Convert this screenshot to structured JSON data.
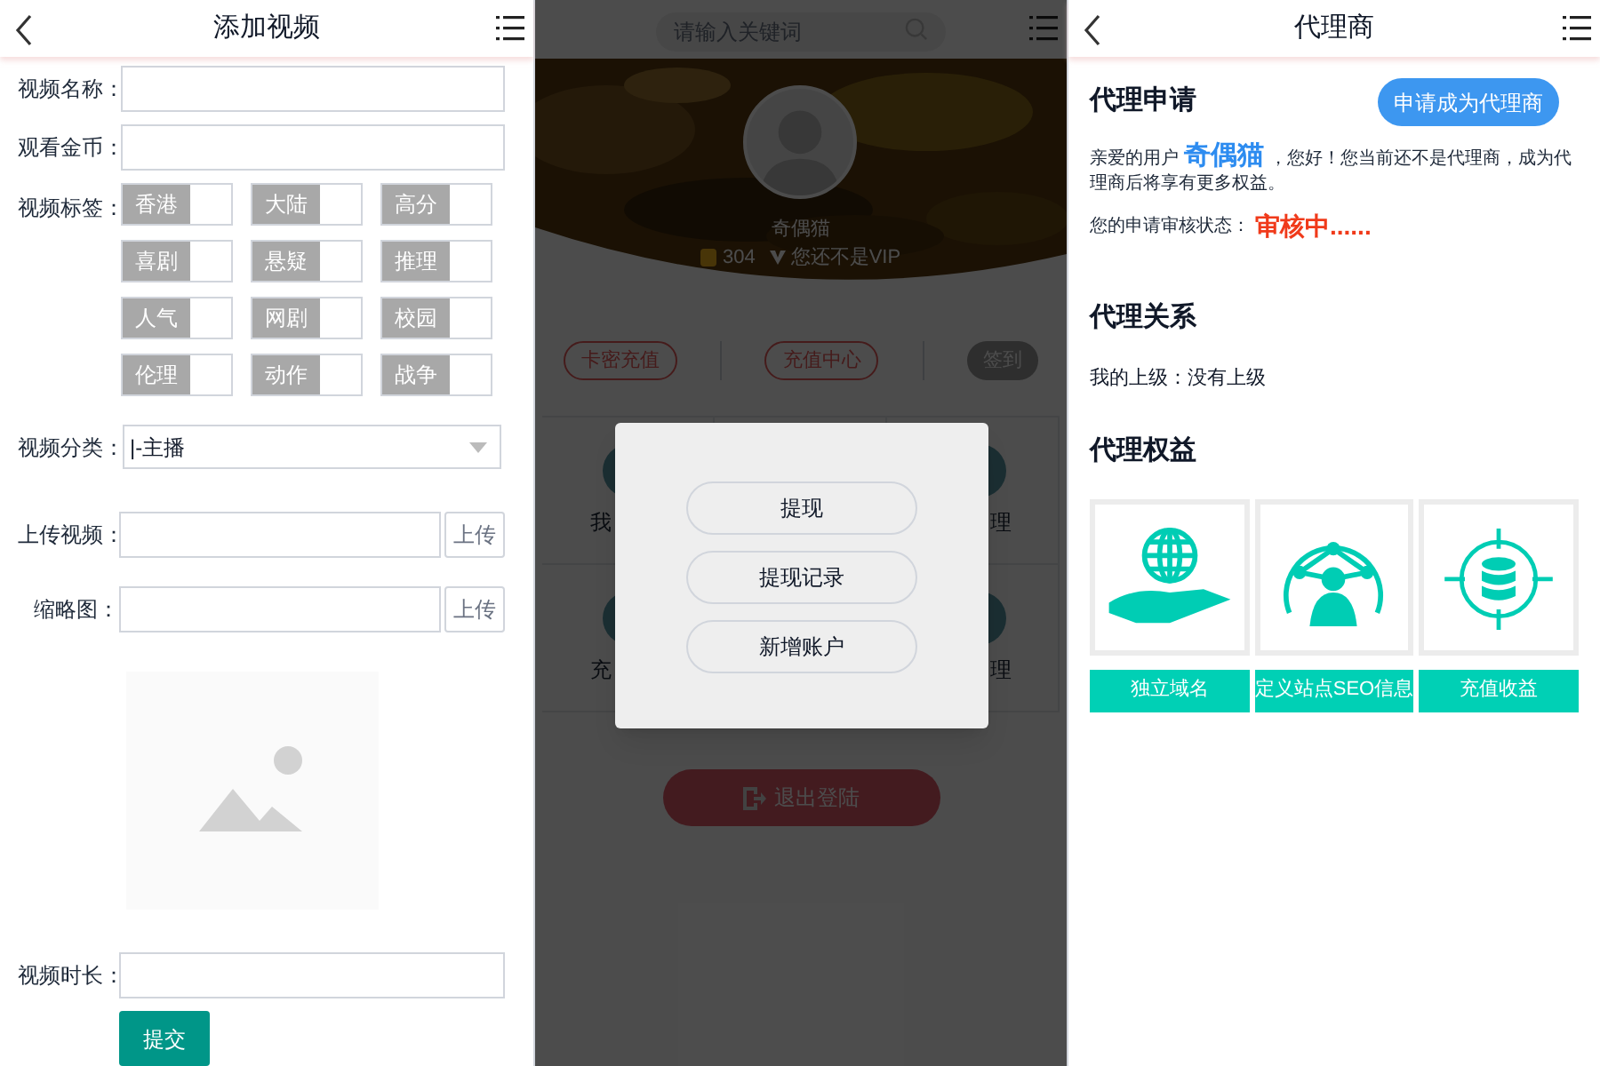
{
  "add_video": {
    "title": "添加视频",
    "fields": [
      {
        "label": "视频名称："
      },
      {
        "label": "观看金币："
      }
    ],
    "tags_label": "视频标签：",
    "tags": [
      {
        "label": "香港",
        "checked": false
      },
      {
        "label": "大陆",
        "checked": false
      },
      {
        "label": "高分",
        "checked": false
      },
      {
        "label": "喜剧",
        "checked": false
      },
      {
        "label": "悬疑",
        "checked": false
      },
      {
        "label": "推理",
        "checked": false
      },
      {
        "label": "人气",
        "checked": false
      },
      {
        "label": "网剧",
        "checked": false
      },
      {
        "label": "校园",
        "checked": false
      },
      {
        "label": "伦理",
        "checked": false
      },
      {
        "label": "动作",
        "checked": false
      },
      {
        "label": "战争",
        "checked": false
      }
    ],
    "category": {
      "label": "视频分类：",
      "value": "|-主播"
    },
    "uploads": [
      {
        "label": "上传视频：",
        "button": "上传"
      },
      {
        "label": "缩略图：",
        "button": "上传"
      }
    ],
    "duration": {
      "label": "视频时长："
    },
    "submit": "提交"
  },
  "profile": {
    "search": {
      "placeholder": "请输入关键词"
    },
    "username": "奇偶猫",
    "coins": "304",
    "vip": "您还不是VIP",
    "actions": [
      {
        "label": "卡密充值",
        "kind": "outline"
      },
      {
        "label": "充值中心",
        "kind": "outline"
      },
      {
        "label": "签到",
        "kind": "filled"
      }
    ],
    "grid": [
      {
        "label": "我"
      },
      {
        "label": "理"
      },
      {
        "label": "充"
      },
      {
        "label": "理"
      }
    ],
    "logout": "退出登陆",
    "dialog": {
      "options": [
        "提现",
        "提现记录",
        "新增账户"
      ]
    }
  },
  "agent": {
    "title": "代理商",
    "apply": {
      "heading": "代理申请",
      "button": "申请成为代理商",
      "greeting_before": "亲爱的用户",
      "name": "奇偶猫",
      "greeting_after": "，您好！您当前还不是代理商，成为代理商后将享有更多权益。",
      "status_label": "您的申请审核状态：",
      "status": "审核中......"
    },
    "relation": {
      "heading": "代理关系",
      "text": "我的上级：没有上级"
    },
    "benefits": {
      "heading": "代理权益",
      "items": [
        {
          "label": "独立域名",
          "kind": "globe"
        },
        {
          "label": "定义站点SEO信息",
          "kind": "network"
        },
        {
          "label": "充值收益",
          "kind": "coins"
        }
      ]
    }
  }
}
